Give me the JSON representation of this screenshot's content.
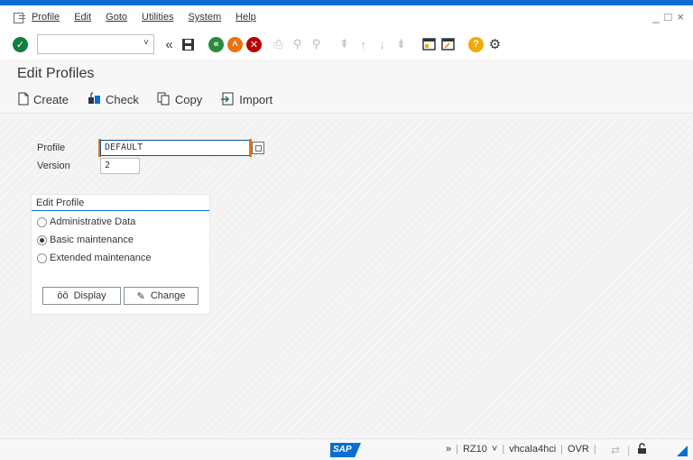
{
  "menubar": {
    "items": [
      "Profile",
      "Edit",
      "Goto",
      "Utilities",
      "System",
      "Help"
    ],
    "window_controls": [
      "_",
      "□",
      "×"
    ]
  },
  "toolbar": {
    "command_value": "",
    "icons": [
      "enter-icon",
      "back-icon",
      "save-icon",
      "exit-icon",
      "cancel-icon",
      "print-icon",
      "find-icon",
      "find-next-icon",
      "first-page-icon",
      "prev-page-icon",
      "next-page-icon",
      "last-page-icon",
      "new-session-icon",
      "shortcut-icon",
      "help-icon",
      "settings-icon"
    ]
  },
  "page": {
    "title": "Edit Profiles"
  },
  "app_toolbar": {
    "create": "Create",
    "check": "Check",
    "copy": "Copy",
    "import": "Import"
  },
  "form": {
    "profile_label": "Profile",
    "profile_value": "DEFAULT",
    "version_label": "Version",
    "version_value": "2"
  },
  "edit_profile": {
    "title": "Edit Profile",
    "options": [
      "Administrative Data",
      "Basic maintenance",
      "Extended maintenance"
    ],
    "selected": "Basic maintenance",
    "display_label": "Display",
    "change_label": "Change"
  },
  "status": {
    "logo": "SAP",
    "more": "»",
    "transaction": "RZ10",
    "dropdown": "˅",
    "server": "vhcala4hci",
    "mode": "OVR"
  },
  "colors": {
    "accent": "#0a6ed1",
    "enter_green": "#107e3e",
    "back_green": "#2b8a3e",
    "exit_orange": "#e9730c",
    "cancel_red": "#bb0000",
    "help_orange": "#f0ab00"
  }
}
